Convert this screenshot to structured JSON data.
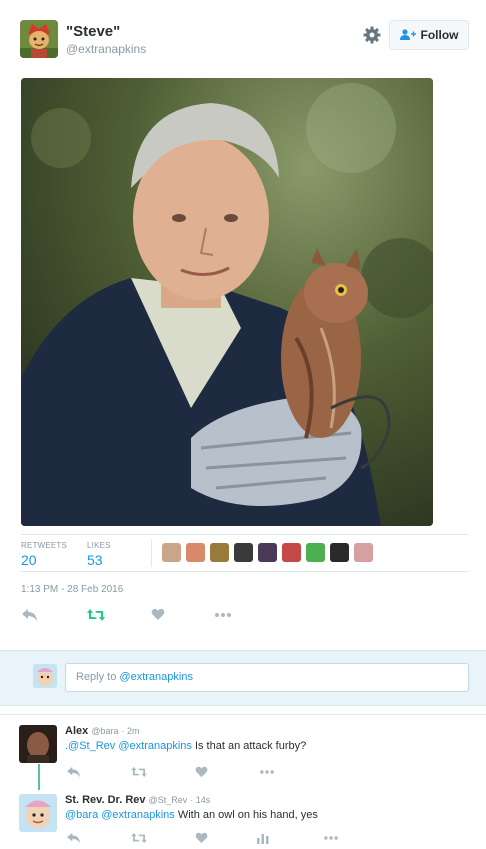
{
  "tweet": {
    "author_name": "\"Steve\"",
    "author_handle": "@extranapkins",
    "follow_label": "Follow",
    "retweets_label": "RETWEETS",
    "retweets_count": "20",
    "likes_label": "LIKES",
    "likes_count": "53",
    "timestamp": "1:13 PM - 28 Feb 2016",
    "liker_avatar_colors": [
      "#c9a68a",
      "#d98a6a",
      "#9a7a3a",
      "#3a3a3a",
      "#4a3a5a",
      "#c44a4a",
      "#4caf50",
      "#2a2a2a",
      "#d6a0a0"
    ],
    "icons": [
      "reply-icon",
      "retweet-icon",
      "like-icon",
      "more-icon",
      "gear-icon",
      "follow-person-icon"
    ],
    "accent_color": "#1b95e0",
    "retweet_active_color": "#19cf86"
  },
  "reply_box": {
    "prefix": "Reply to ",
    "mention": "@extranapkins"
  },
  "replies": [
    {
      "name": "Alex",
      "handle": "@bara",
      "time": "2m",
      "mentions": ".@St_Rev @extranapkins",
      "text": " Is that an attack furby?"
    },
    {
      "name": "St. Rev. Dr. Rev",
      "handle": "@St_Rev",
      "time": "14s",
      "mentions": "@bara @extranapkins",
      "text": " With an owl on his hand, yes"
    }
  ]
}
